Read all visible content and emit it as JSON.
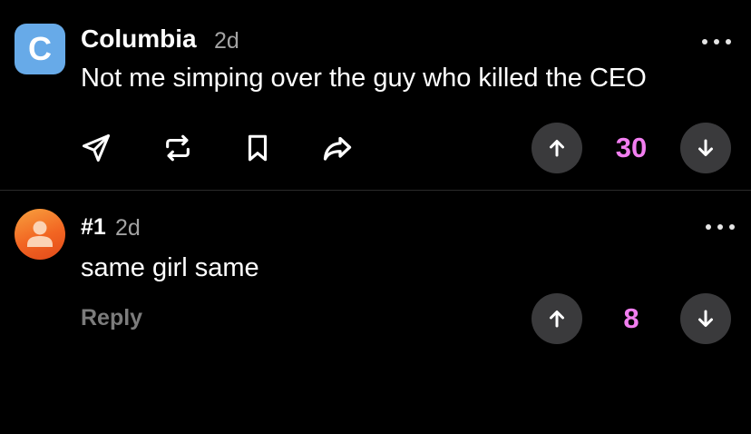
{
  "post": {
    "avatar_letter": "C",
    "author": "Columbia",
    "time": "2d",
    "text": "Not me simping over the guy who killed the CEO",
    "vote_count": "30",
    "colors": {
      "avatar_bg": "#67aae8",
      "vote_count": "#f27ef0"
    },
    "actions": [
      "send-icon",
      "repost-icon",
      "bookmark-icon",
      "share-icon"
    ]
  },
  "comment": {
    "author": "#1",
    "time": "2d",
    "text": "same girl same",
    "reply_label": "Reply",
    "vote_count": "8",
    "colors": {
      "avatar_bg": "#f26522",
      "vote_count": "#f27ef0"
    }
  },
  "theme": {
    "background": "#000000",
    "divider": "#2a2a2a",
    "button_bg": "#3a3a3c"
  }
}
